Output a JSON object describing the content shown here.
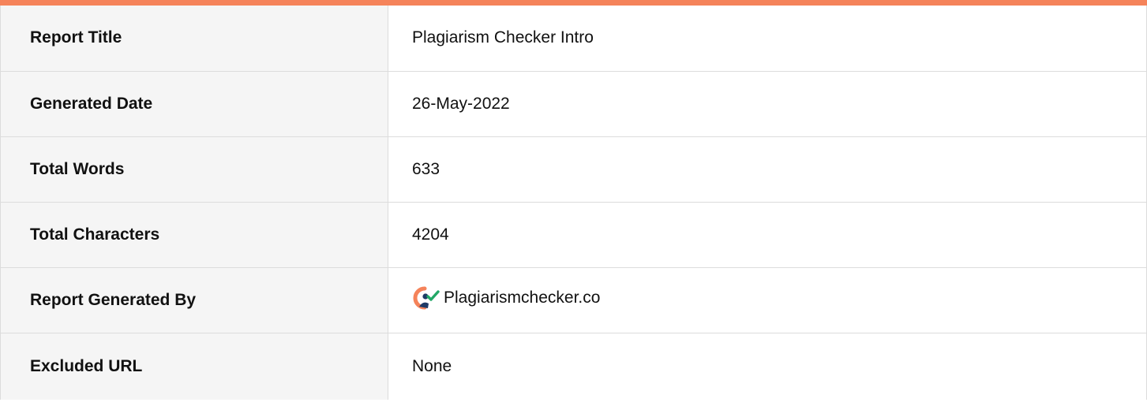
{
  "colors": {
    "accent_bar": "#f5835a",
    "label_background": "#f5f5f5",
    "border": "#dcdcdc"
  },
  "rows": [
    {
      "label": "Report Title",
      "value": "Plagiarism Checker Intro"
    },
    {
      "label": "Generated Date",
      "value": "26-May-2022"
    },
    {
      "label": "Total Words",
      "value": "633"
    },
    {
      "label": "Total Characters",
      "value": "4204"
    },
    {
      "label": "Report Generated By",
      "value": "Plagiarismchecker.co",
      "icon": "plagiarismchecker-logo-icon"
    },
    {
      "label": "Excluded URL",
      "value": "None"
    }
  ]
}
